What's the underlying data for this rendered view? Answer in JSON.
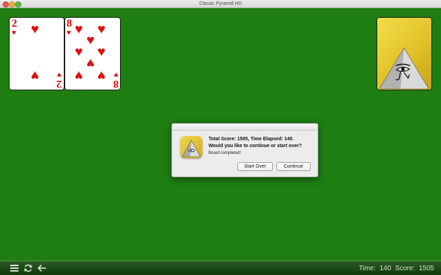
{
  "window": {
    "title": "Classic Pyramid HD"
  },
  "cards": [
    {
      "rank": "2",
      "suit": "heart",
      "color": "#e01010"
    },
    {
      "rank": "8",
      "suit": "heart",
      "color": "#e01010"
    }
  ],
  "stock": {
    "face": "down",
    "design": "pyramid-eye"
  },
  "dialog": {
    "message_line1": "Total Score: 1505, Time Elapsed: 140.",
    "message_line2": "Would you like to continue or start over?",
    "info": "Board completed!",
    "start_over_label": "Start Over",
    "continue_label": "Continue"
  },
  "status": {
    "time_label": "Time:",
    "time_value": "140",
    "score_label": "Score:",
    "score_value": "1505"
  },
  "toolbar": {
    "icons": [
      "menu-icon",
      "refresh-icon",
      "back-arrow-icon"
    ]
  },
  "colors": {
    "felt": "#1e7e12",
    "card_back": "#e2c12a",
    "suit_red": "#e01010"
  }
}
